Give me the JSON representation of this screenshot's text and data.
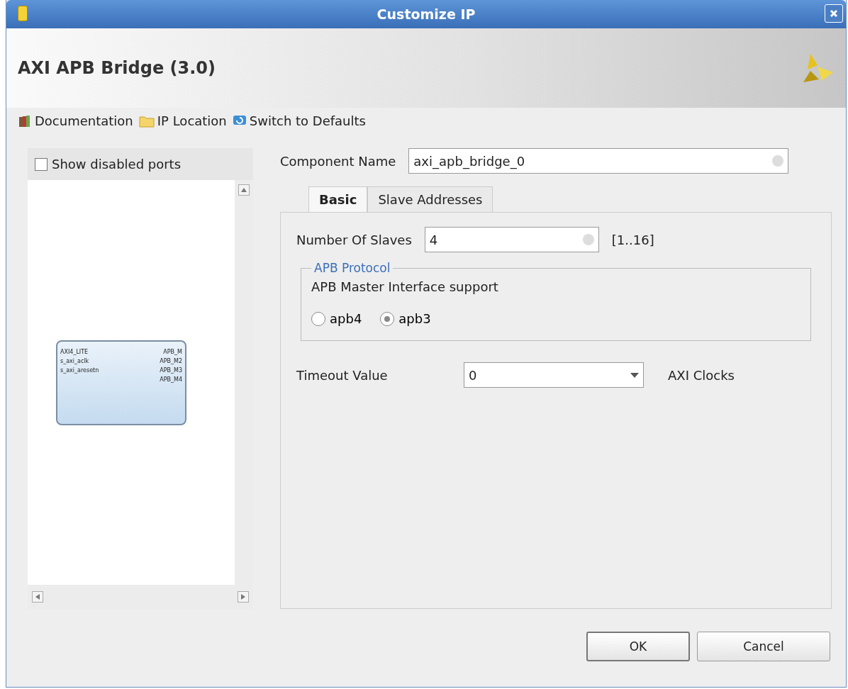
{
  "window": {
    "title": "Customize IP"
  },
  "header": {
    "title": "AXI APB Bridge (3.0)"
  },
  "toolbar": [
    "Documentation",
    "IP Location",
    "Switch to Defaults"
  ],
  "left_panel": {
    "show_disabled_ports": {
      "label": "Show disabled ports",
      "checked": false
    },
    "block": {
      "inputs": [
        "AXI4_LITE",
        "s_axi_aclk",
        "s_axi_aresetn"
      ],
      "outputs": [
        "APB_M",
        "APB_M2",
        "APB_M3",
        "APB_M4"
      ]
    }
  },
  "component_name": {
    "label": "Component Name",
    "value": "axi_apb_bridge_0"
  },
  "tabs": [
    {
      "label": "Basic",
      "selected": true
    },
    {
      "label": "Slave Addresses",
      "selected": false
    }
  ],
  "number_of_slaves": {
    "label": "Number Of Slaves",
    "value": "4",
    "range": "[1..16]"
  },
  "apb_protocol": {
    "title": "APB Protocol",
    "label": "APB Master Interface support",
    "options": [
      {
        "label": "apb4",
        "selected": false
      },
      {
        "label": "apb3",
        "selected": true
      }
    ]
  },
  "timeout": {
    "label": "Timeout Value",
    "value": "0",
    "unit": "AXI Clocks"
  },
  "buttons": [
    "OK",
    "Cancel"
  ]
}
